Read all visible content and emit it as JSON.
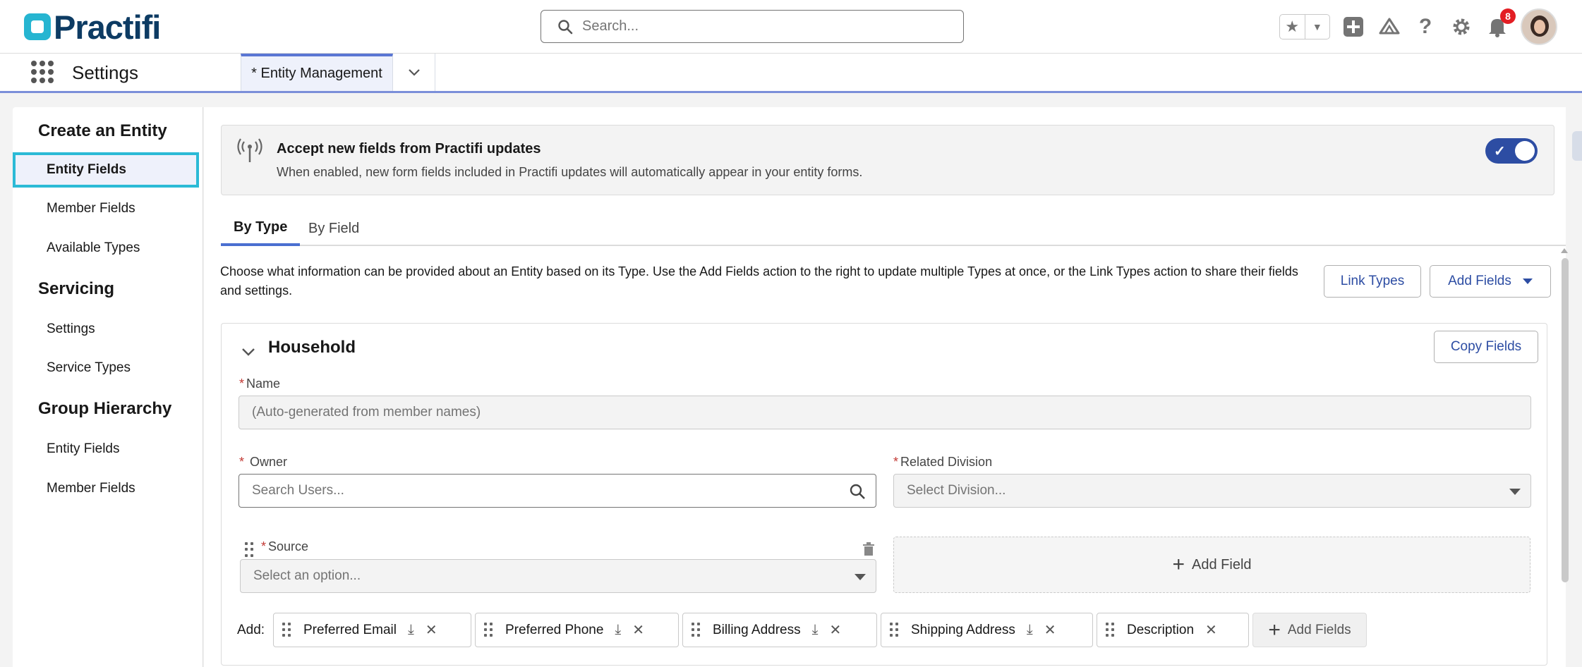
{
  "header": {
    "brand": "Practifi",
    "search_placeholder": "Search...",
    "notification_count": "8"
  },
  "nav": {
    "app_name": "Settings",
    "tab_label": "* Entity Management"
  },
  "sidebar": {
    "sections": [
      {
        "heading": "Create an Entity",
        "items": [
          "Entity Fields",
          "Member Fields",
          "Available Types"
        ]
      },
      {
        "heading": "Servicing",
        "items": [
          "Settings",
          "Service Types"
        ]
      },
      {
        "heading": "Group Hierarchy",
        "items": [
          "Entity Fields",
          "Member Fields"
        ]
      }
    ]
  },
  "banner": {
    "title": "Accept new fields from Practifi updates",
    "text": "When enabled, new form fields included in Practifi updates will automatically appear in your entity forms.",
    "enabled": true
  },
  "tabs": [
    "By Type",
    "By Field"
  ],
  "description": "Choose what information can be provided about an Entity based on its Type. Use the Add Fields action to the right to update multiple Types at once, or the Link Types action to share their fields and settings.",
  "actions": {
    "link_types": "Link Types",
    "add_fields": "Add Fields"
  },
  "card": {
    "title": "Household",
    "copy_fields": "Copy Fields",
    "name_label": "Name",
    "name_placeholder": "(Auto-generated from member names)",
    "owner_label": "Owner",
    "owner_placeholder": "Search Users...",
    "division_label": "Related Division",
    "division_placeholder": "Select Division...",
    "source_label": "Source",
    "source_placeholder": "Select an option...",
    "add_field": "Add Field",
    "add_label": "Add:",
    "pills": [
      "Preferred Email",
      "Preferred Phone",
      "Billing Address",
      "Shipping Address",
      "Description"
    ],
    "add_fields": "Add Fields"
  }
}
